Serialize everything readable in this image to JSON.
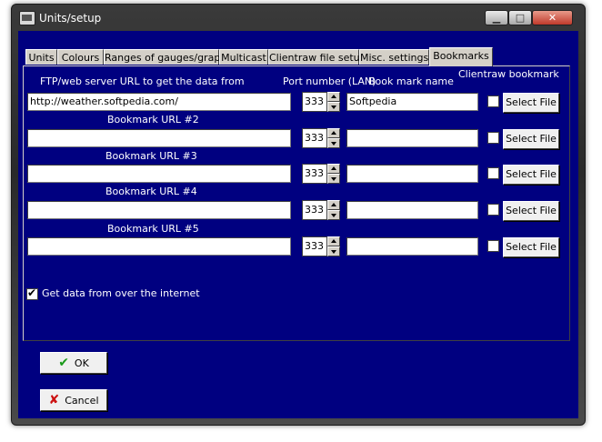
{
  "window": {
    "title": "Units/setup"
  },
  "tabs": [
    {
      "label": "Units"
    },
    {
      "label": "Colours"
    },
    {
      "label": "Ranges of gauges/graph"
    },
    {
      "label": "Multicast"
    },
    {
      "label": "Clientraw file setup"
    },
    {
      "label": "Misc. settings"
    },
    {
      "label": "Bookmarks"
    }
  ],
  "active_tab": "Bookmarks",
  "headers": {
    "ftp": "FTP/web server  URL to get the data from",
    "port": "Port number (LAN)",
    "bookmark_name": "Book mark name",
    "clientraw_bookmark": "Clientraw bookmark"
  },
  "rows": [
    {
      "label": "",
      "url": "http://weather.softpedia.com/",
      "port": "333",
      "name": "Softpedia",
      "checked": false,
      "button": "Select File"
    },
    {
      "label": "Bookmark URL #2",
      "url": "",
      "port": "333",
      "name": "",
      "checked": false,
      "button": "Select File"
    },
    {
      "label": "Bookmark URL #3",
      "url": "",
      "port": "333",
      "name": "",
      "checked": false,
      "button": "Select File"
    },
    {
      "label": "Bookmark URL #4",
      "url": "",
      "port": "333",
      "name": "",
      "checked": false,
      "button": "Select File"
    },
    {
      "label": "Bookmark URL #5",
      "url": "",
      "port": "333",
      "name": "",
      "checked": false,
      "button": "Select File"
    }
  ],
  "internet": {
    "label": "Get data from over the internet",
    "checked": true
  },
  "buttons": {
    "ok": "OK",
    "cancel": "Cancel"
  },
  "colors": {
    "client_bg": "#000080",
    "button_face": "#f0f0f0"
  }
}
